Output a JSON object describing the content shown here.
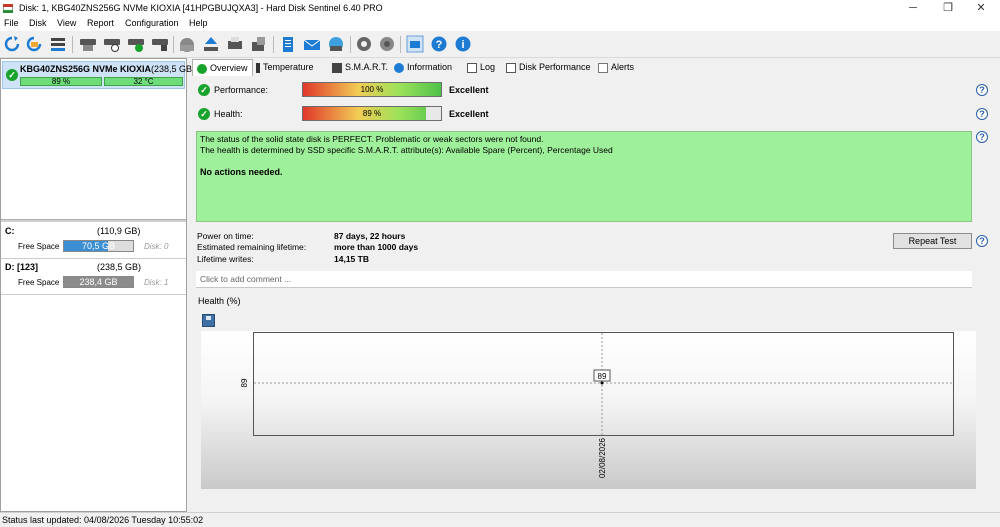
{
  "window": {
    "title": "Disk: 1, KBG40ZNS256G NVMe KIOXIA [41HPGBUJQXA3]  -  Hard Disk Sentinel 6.40 PRO",
    "minimize": "─",
    "maximize": "❐",
    "close": "✕"
  },
  "menu": [
    {
      "label": "File"
    },
    {
      "label": "Disk"
    },
    {
      "label": "View"
    },
    {
      "label": "Report"
    },
    {
      "label": "Configuration"
    },
    {
      "label": "Help"
    }
  ],
  "toolbar": {
    "icons": [
      "refresh-icon",
      "refresh-all-icon",
      "disk-list-icon",
      "disk-drive-icon",
      "disk-test-icon",
      "disk-check-icon",
      "disk-alert-icon",
      "helmet-icon",
      "eject-icon",
      "printer-icon",
      "export-icon",
      "notes-icon",
      "mail-icon",
      "network-icon",
      "settings-icon",
      "configuration-icon",
      "screenshot-icon",
      "help-icon",
      "info-icon"
    ]
  },
  "disk_list": {
    "name": "KBG40ZNS256G NVMe KIOXIA",
    "size": "(238,5 GB",
    "health": "89 %",
    "health_value": 89,
    "temperature": "32 °C"
  },
  "volumes": [
    {
      "name": "C:",
      "size": "(110,9 GB)",
      "free_label": "Free Space",
      "free": "70,5 GB",
      "free_fraction": 0.64,
      "disk": "Disk: 0",
      "bar_color": "#3d8fd4"
    },
    {
      "name": "D: [123]",
      "size": "(238,5 GB)",
      "free_label": "Free Space",
      "free": "238,4 GB",
      "free_fraction": 1.0,
      "disk": "Disk: 1",
      "bar_color": "#8c8c8c"
    }
  ],
  "tabs": [
    {
      "label": "Overview"
    },
    {
      "label": "Temperature"
    },
    {
      "label": "S.M.A.R.T."
    },
    {
      "label": "Information"
    },
    {
      "label": "Log"
    },
    {
      "label": "Disk Performance"
    },
    {
      "label": "Alerts"
    }
  ],
  "overview": {
    "performance_label": "Performance:",
    "performance_value": "100 %",
    "performance_percent": 100,
    "performance_status": "Excellent",
    "health_label": "Health:",
    "health_value": "89 %",
    "health_percent": 89,
    "health_status": "Excellent",
    "status_lines": [
      "The status of the solid state disk is PERFECT. Problematic or weak sectors were not found.",
      "The health is determined by SSD specific S.M.A.R.T. attribute(s):  Available Spare (Percent), Percentage Used"
    ],
    "status_action": "No actions needed.",
    "power_on_label": "Power on time:",
    "power_on_value": "87 days, 22 hours",
    "lifetime_label": "Estimated remaining lifetime:",
    "lifetime_value": "more than 1000 days",
    "writes_label": "Lifetime writes:",
    "writes_value": "14,15 TB",
    "repeat_button": "Repeat Test",
    "comment_placeholder": "Click to add comment ..."
  },
  "health_graph": {
    "tab": "Health (%)",
    "ytick": "89",
    "xtick": "02/08/2026",
    "point_label": "89"
  },
  "chart_data": {
    "type": "line",
    "title": "Health (%)",
    "x": [
      "02/08/2026"
    ],
    "series": [
      {
        "values": [
          89
        ]
      }
    ],
    "y_ticks": [
      89
    ]
  },
  "statusbar": {
    "text": "Status last updated: 04/08/2026 Tuesday 10:55:02"
  },
  "colors": {
    "status_ok": "#9ff09a",
    "check_green": "#18a32c",
    "selected_disk": "#cfe3f7"
  }
}
